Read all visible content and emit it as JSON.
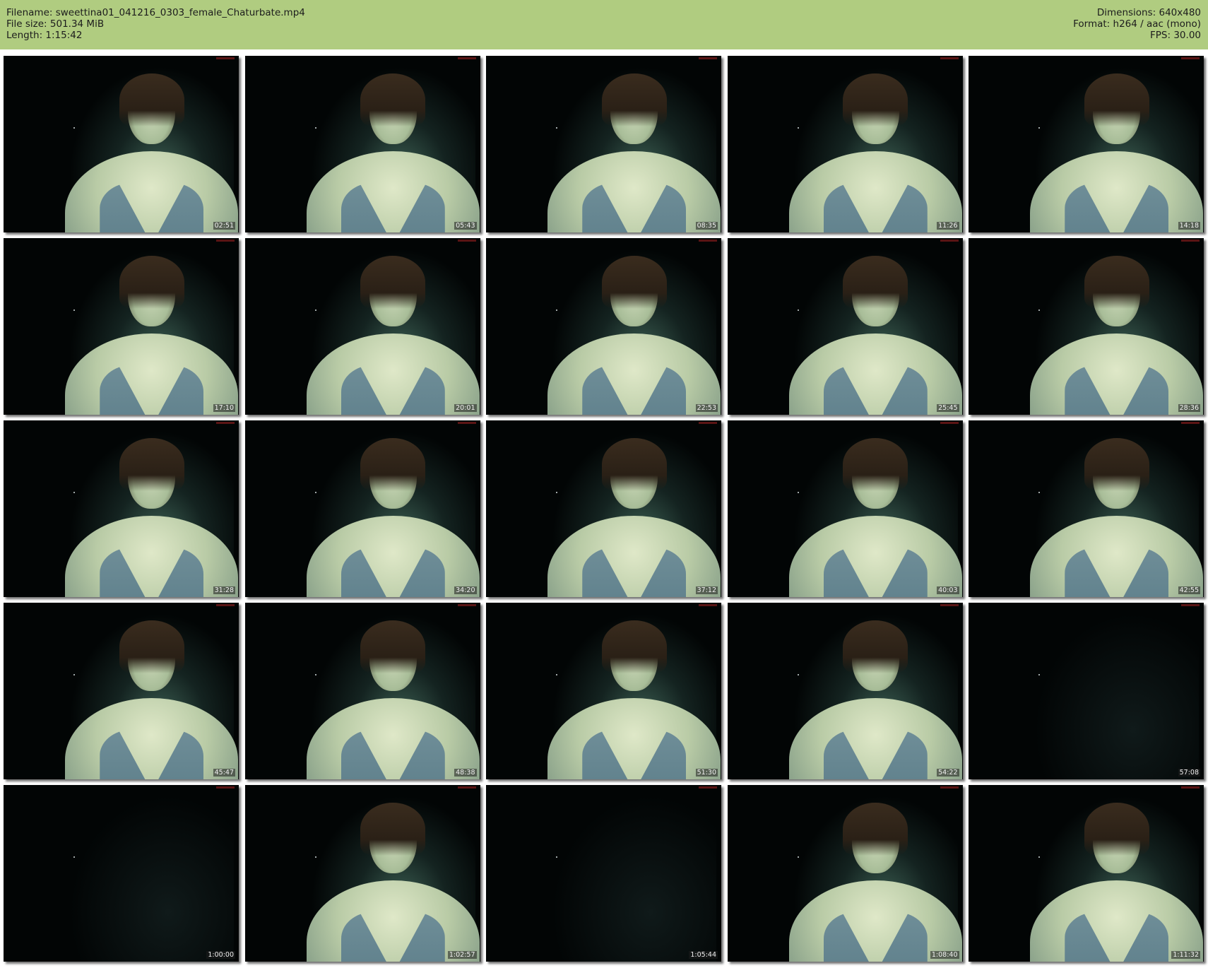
{
  "header": {
    "filename": "Filename: sweettina01_041216_0303_female_Chaturbate.mp4",
    "filesize": "File size: 501.34 MiB",
    "length": "Length: 1:15:42",
    "dimensions": "Dimensions: 640x480",
    "format": "Format: h264 / aac (mono)",
    "fps": "FPS: 30.00"
  },
  "thumbnails": [
    {
      "time": "02:51",
      "person": true
    },
    {
      "time": "05:43",
      "person": true
    },
    {
      "time": "08:35",
      "person": true
    },
    {
      "time": "11:26",
      "person": true
    },
    {
      "time": "14:18",
      "person": true
    },
    {
      "time": "17:10",
      "person": true
    },
    {
      "time": "20:01",
      "person": true
    },
    {
      "time": "22:53",
      "person": true
    },
    {
      "time": "25:45",
      "person": true
    },
    {
      "time": "28:36",
      "person": true
    },
    {
      "time": "31:28",
      "person": true
    },
    {
      "time": "34:20",
      "person": true
    },
    {
      "time": "37:12",
      "person": true
    },
    {
      "time": "40:03",
      "person": true
    },
    {
      "time": "42:55",
      "person": true
    },
    {
      "time": "45:47",
      "person": true
    },
    {
      "time": "48:38",
      "person": true
    },
    {
      "time": "51:30",
      "person": true
    },
    {
      "time": "54:22",
      "person": true
    },
    {
      "time": "57:08",
      "person": false
    },
    {
      "time": "1:00:00",
      "person": false
    },
    {
      "time": "1:02:57",
      "person": true
    },
    {
      "time": "1:05:44",
      "person": false
    },
    {
      "time": "1:08:40",
      "person": true
    },
    {
      "time": "1:11:32",
      "person": true
    }
  ]
}
